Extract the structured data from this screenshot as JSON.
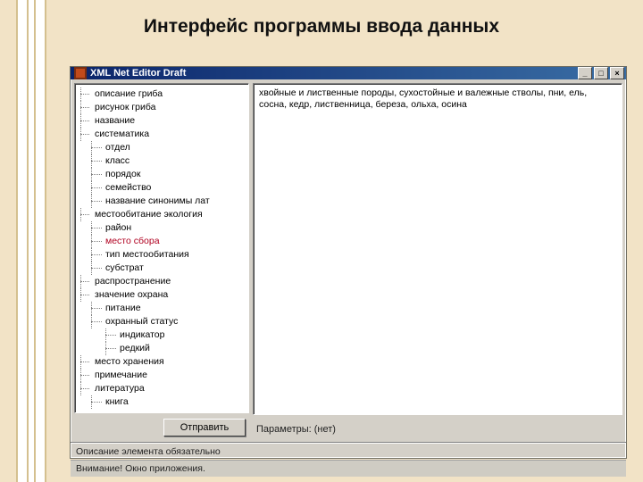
{
  "slide": {
    "title": "Интерфейс программы ввода данных"
  },
  "window": {
    "title": "XML Net Editor Draft",
    "buttons": {
      "min": "_",
      "max": "□",
      "close": "×"
    }
  },
  "tree": {
    "selected_index": 11,
    "nodes": [
      {
        "label": "описание гриба",
        "level": 0
      },
      {
        "label": "рисунок гриба",
        "level": 0
      },
      {
        "label": "название",
        "level": 0
      },
      {
        "label": "систематика",
        "level": 0
      },
      {
        "label": "отдел",
        "level": 1
      },
      {
        "label": "класс",
        "level": 1
      },
      {
        "label": "порядок",
        "level": 1
      },
      {
        "label": "семейство",
        "level": 1
      },
      {
        "label": "название синонимы лат",
        "level": 1
      },
      {
        "label": "местообитание экология",
        "level": 0
      },
      {
        "label": "район",
        "level": 1
      },
      {
        "label": "место сбора",
        "level": 1
      },
      {
        "label": "тип местообитания",
        "level": 1
      },
      {
        "label": "субстрат",
        "level": 1
      },
      {
        "label": "распространение",
        "level": 0
      },
      {
        "label": "значение охрана",
        "level": 0
      },
      {
        "label": "питание",
        "level": 1
      },
      {
        "label": "охранный статус",
        "level": 1
      },
      {
        "label": "индикатор",
        "level": 2
      },
      {
        "label": "редкий",
        "level": 2
      },
      {
        "label": "место хранения",
        "level": 0
      },
      {
        "label": "примечание",
        "level": 0
      },
      {
        "label": "литература",
        "level": 0
      },
      {
        "label": "книга",
        "level": 1
      }
    ],
    "submit_label": "Отправить"
  },
  "detail": {
    "text": "хвойные и лиственные породы, сухостойные и валежные стволы, пни, ель, сосна, кедр, лиственница, береза, ольха, осина"
  },
  "params": {
    "label": "Параметры: (нет)"
  },
  "status": {
    "line1": "Описание элемента обязательно",
    "line2": "Внимание! Окно приложения."
  }
}
